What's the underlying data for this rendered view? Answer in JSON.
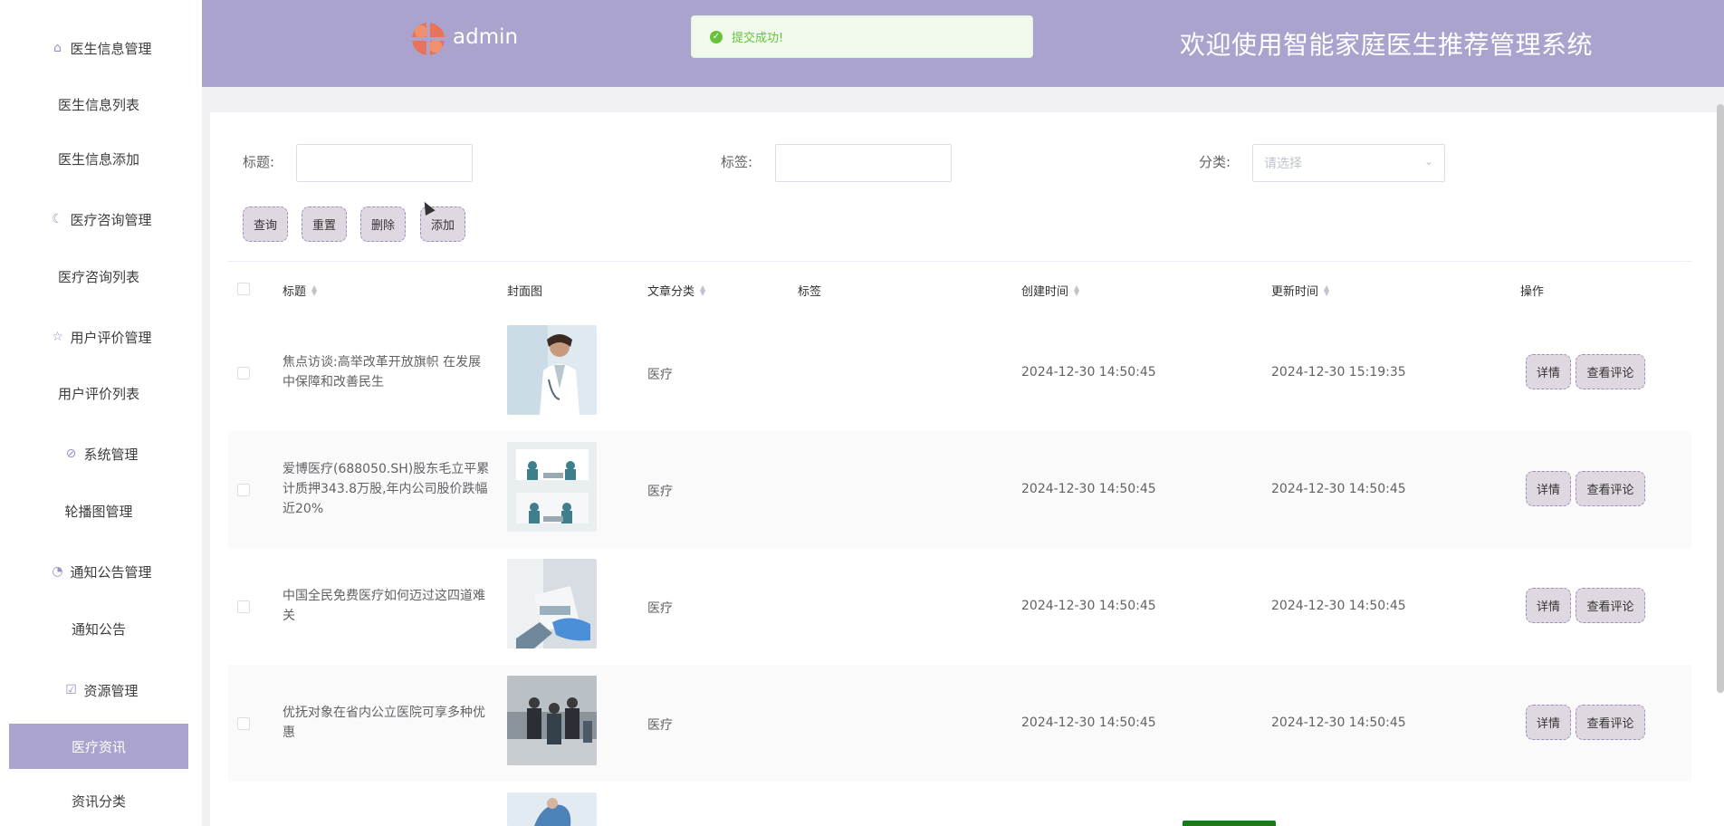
{
  "sidebar": {
    "groups": [
      {
        "label": "医生信息管理",
        "icon": "hospital-icon"
      },
      {
        "label": "医疗咨询管理",
        "icon": "chat-icon"
      },
      {
        "label": "用户评价管理",
        "icon": "star-icon"
      },
      {
        "label": "系统管理",
        "icon": "compass-icon"
      },
      {
        "label": "通知公告管理",
        "icon": "bell-icon"
      },
      {
        "label": "资源管理",
        "icon": "calendar-check-icon"
      }
    ],
    "items": [
      {
        "label": "医生信息列表"
      },
      {
        "label": "医生信息添加"
      },
      {
        "label": "医疗咨询列表"
      },
      {
        "label": "用户评价列表"
      },
      {
        "label": "轮播图管理"
      },
      {
        "label": "通知公告"
      },
      {
        "label": "医疗资讯",
        "active": true
      },
      {
        "label": "资讯分类"
      }
    ]
  },
  "header": {
    "username": "admin",
    "welcome": "欢迎使用智能家庭医生推荐管理系统",
    "toast": "提交成功!"
  },
  "filters": {
    "title_label": "标题:",
    "tag_label": "标签:",
    "category_label": "分类:",
    "category_placeholder": "请选择"
  },
  "actions": {
    "query": "查询",
    "reset": "重置",
    "delete": "删除",
    "add": "添加"
  },
  "table": {
    "columns": [
      "标题",
      "封面图",
      "文章分类",
      "标签",
      "创建时间",
      "更新时间",
      "操作"
    ],
    "rows": [
      {
        "title": "焦点访谈:高举改革开放旗帜 在发展中保障和改善民生",
        "category": "医疗",
        "tag": "",
        "created": "2024-12-30 14:50:45",
        "updated": "2024-12-30 15:19:35"
      },
      {
        "title": "爱博医疗(688050.SH)股东毛立平累计质押343.8万股,年内公司股价跌幅近20%",
        "category": "医疗",
        "tag": "",
        "created": "2024-12-30 14:50:45",
        "updated": "2024-12-30 14:50:45"
      },
      {
        "title": "中国全民免费医疗如何迈过这四道难关",
        "category": "医疗",
        "tag": "",
        "created": "2024-12-30 14:50:45",
        "updated": "2024-12-30 14:50:45"
      },
      {
        "title": "优抚对象在省内公立医院可享多种优惠",
        "category": "医疗",
        "tag": "",
        "created": "2024-12-30 14:50:45",
        "updated": "2024-12-30 14:50:45"
      }
    ],
    "detail_label": "详情",
    "comments_label": "查看评论"
  },
  "colors": {
    "accent": "#aaa3cd",
    "button_bg": "#e0d8e0",
    "success": "#67c23a"
  }
}
